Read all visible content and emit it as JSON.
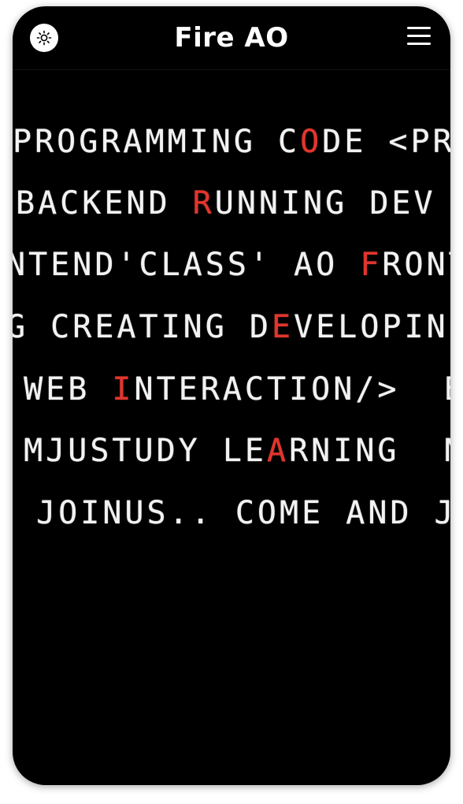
{
  "header": {
    "brand": "Fire AO",
    "theme_icon": "sun-icon",
    "menu_icon": "hamburger-menu-icon"
  },
  "colors": {
    "background": "#000000",
    "text": "#f2f2f2",
    "highlight": "#e1352c"
  },
  "ticker": {
    "rows": [
      {
        "before": "PROGRAMMING C",
        "hi": "O",
        "after": "DE <PR"
      },
      {
        "before": "BACKEND ",
        "hi": "R",
        "after": "UNNING DEV "
      },
      {
        "before": "NTEND'CLASS' AO ",
        "hi": "F",
        "after": "RONT"
      },
      {
        "before": "G CREATING D",
        "hi": "E",
        "after": "VELOPIN"
      },
      {
        "before": " WEB ",
        "hi": "I",
        "after": "NTERACTION/>  E"
      },
      {
        "before": " MJUSTUDY LE",
        "hi": "A",
        "after": "RNING  N"
      },
      {
        "before": " JOINUS.. COME AND J",
        "hi": "",
        "after": ""
      }
    ]
  }
}
